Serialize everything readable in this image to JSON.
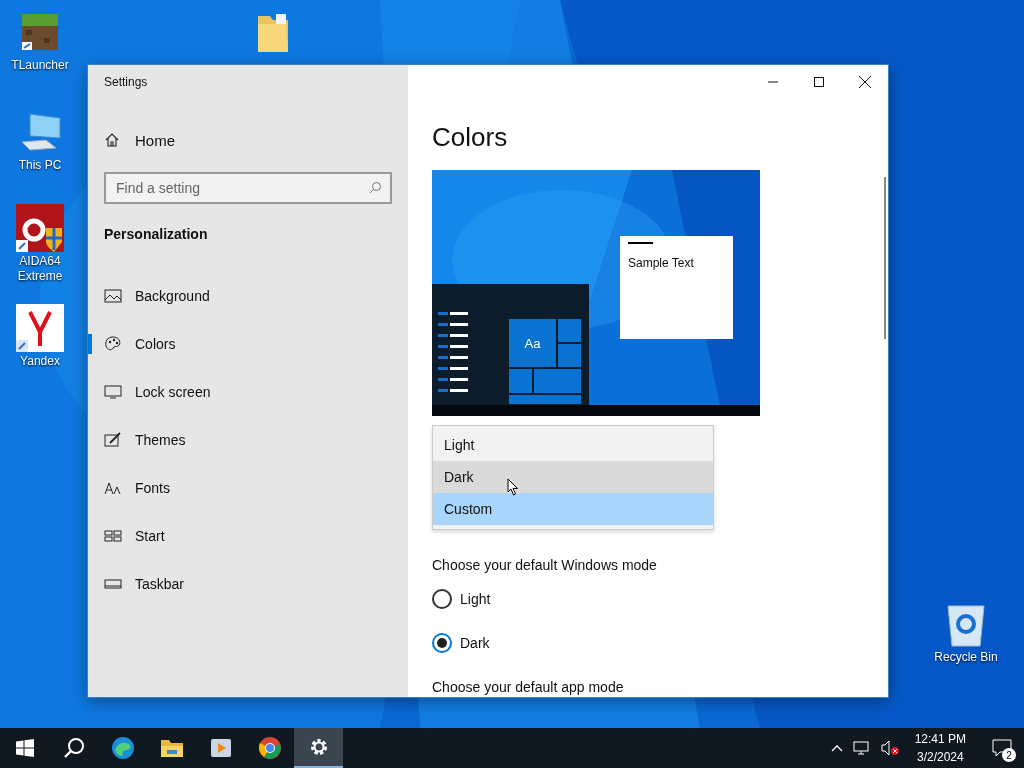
{
  "desktop": {
    "icons": [
      {
        "label": "TLauncher"
      },
      {
        "label": "This PC"
      },
      {
        "label": "AIDA64 Extreme"
      },
      {
        "label": "Yandex"
      },
      {
        "label": "Recycle Bin"
      }
    ]
  },
  "window": {
    "title": "Settings"
  },
  "sidebar": {
    "home": "Home",
    "search": {
      "placeholder": "Find a setting"
    },
    "section": "Personalization",
    "items": [
      {
        "label": "Background",
        "selected": false
      },
      {
        "label": "Colors",
        "selected": true
      },
      {
        "label": "Lock screen",
        "selected": false
      },
      {
        "label": "Themes",
        "selected": false
      },
      {
        "label": "Fonts",
        "selected": false
      },
      {
        "label": "Start",
        "selected": false
      },
      {
        "label": "Taskbar",
        "selected": false
      }
    ]
  },
  "content": {
    "heading": "Colors",
    "preview": {
      "tile_label": "Aa",
      "sample_text": "Sample Text"
    },
    "dropdown": {
      "options": [
        {
          "label": "Light",
          "selected": false,
          "hovered": false
        },
        {
          "label": "Dark",
          "selected": false,
          "hovered": true
        },
        {
          "label": "Custom",
          "selected": true,
          "hovered": false
        }
      ]
    },
    "windows_mode": {
      "label": "Choose your default Windows mode",
      "options": [
        {
          "label": "Light",
          "selected": false
        },
        {
          "label": "Dark",
          "selected": true
        }
      ]
    },
    "app_mode": {
      "label": "Choose your default app mode"
    }
  },
  "taskbar": {
    "apps": [
      {
        "active": false
      },
      {
        "active": false
      },
      {
        "active": false
      },
      {
        "active": false
      },
      {
        "active": true
      }
    ],
    "time": "12:41 PM",
    "date": "3/2/2024",
    "notifications": "2"
  }
}
